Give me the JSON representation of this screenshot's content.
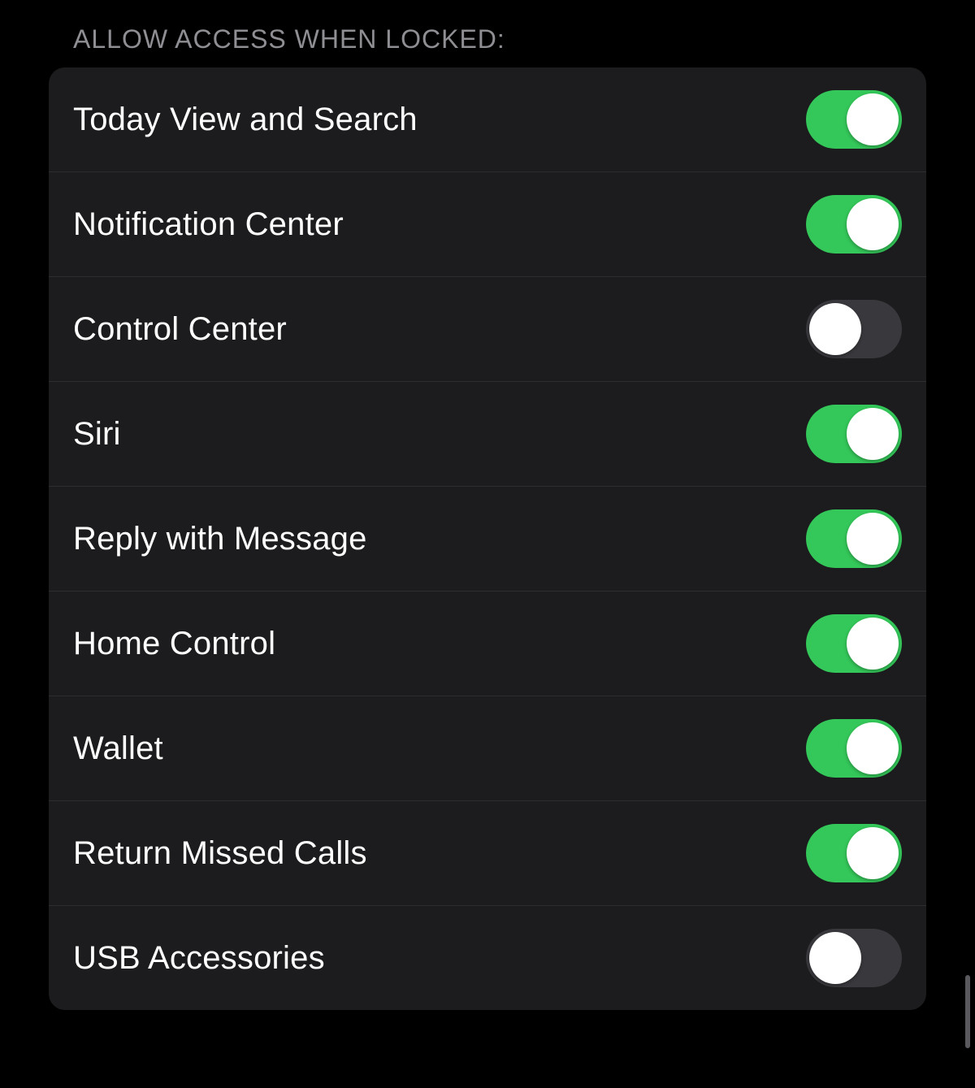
{
  "section": {
    "header": "ALLOW ACCESS WHEN LOCKED:",
    "items": [
      {
        "label": "Today View and Search",
        "enabled": true,
        "key": "today-view-and-search"
      },
      {
        "label": "Notification Center",
        "enabled": true,
        "key": "notification-center"
      },
      {
        "label": "Control Center",
        "enabled": false,
        "key": "control-center"
      },
      {
        "label": "Siri",
        "enabled": true,
        "key": "siri"
      },
      {
        "label": "Reply with Message",
        "enabled": true,
        "key": "reply-with-message"
      },
      {
        "label": "Home Control",
        "enabled": true,
        "key": "home-control"
      },
      {
        "label": "Wallet",
        "enabled": true,
        "key": "wallet"
      },
      {
        "label": "Return Missed Calls",
        "enabled": true,
        "key": "return-missed-calls"
      },
      {
        "label": "USB Accessories",
        "enabled": false,
        "key": "usb-accessories"
      }
    ]
  },
  "colors": {
    "toggle_on": "#34c759",
    "toggle_off": "#39393d",
    "panel_bg": "#1c1c1e",
    "text": "#ffffff",
    "header_text": "#8e8e93"
  }
}
